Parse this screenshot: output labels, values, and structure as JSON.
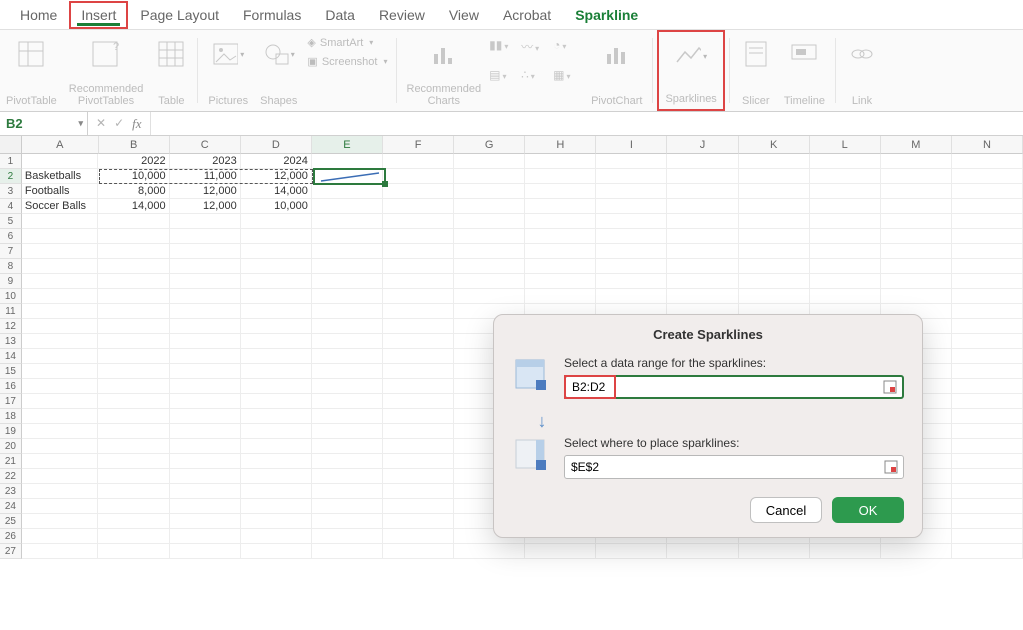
{
  "tabs": [
    "Home",
    "Insert",
    "Page Layout",
    "Formulas",
    "Data",
    "Review",
    "View",
    "Acrobat",
    "Sparkline"
  ],
  "active_tab_index": 8,
  "highlighted_tab_index": 1,
  "ribbon": {
    "pivottable": "PivotTable",
    "rec_pivot": "Recommended\nPivotTables",
    "table": "Table",
    "pictures": "Pictures",
    "shapes": "Shapes",
    "smartart": "SmartArt",
    "screenshot": "Screenshot",
    "rec_charts": "Recommended\nCharts",
    "pivotchart": "PivotChart",
    "sparklines": "Sparklines",
    "slicer": "Slicer",
    "timeline": "Timeline",
    "link": "Link"
  },
  "name_box": "B2",
  "columns": [
    "A",
    "B",
    "C",
    "D",
    "E",
    "F",
    "G",
    "H",
    "I",
    "J",
    "K",
    "L",
    "M",
    "N"
  ],
  "row_count": 27,
  "selected_row": 2,
  "selected_col": "E",
  "data": {
    "r1": {
      "B": "2022",
      "C": "2023",
      "D": "2024"
    },
    "r2": {
      "A": "Basketballs",
      "B": "10,000",
      "C": "11,000",
      "D": "12,000"
    },
    "r3": {
      "A": "Footballs",
      "B": "8,000",
      "C": "12,000",
      "D": "14,000"
    },
    "r4": {
      "A": "Soccer Balls",
      "B": "14,000",
      "C": "12,000",
      "D": "10,000"
    }
  },
  "dialog": {
    "title": "Create Sparklines",
    "label_data": "Select a data range for the sparklines:",
    "input_data": "B2:D2",
    "label_loc": "Select where to place sparklines:",
    "input_loc": "$E$2",
    "cancel": "Cancel",
    "ok": "OK"
  },
  "chart_data": {
    "type": "line",
    "title": "Sparkline in E2 (Basketballs row)",
    "categories": [
      "2022",
      "2023",
      "2024"
    ],
    "values": [
      10000,
      11000,
      12000
    ],
    "xlabel": "",
    "ylabel": "",
    "ylim": [
      10000,
      12000
    ]
  }
}
